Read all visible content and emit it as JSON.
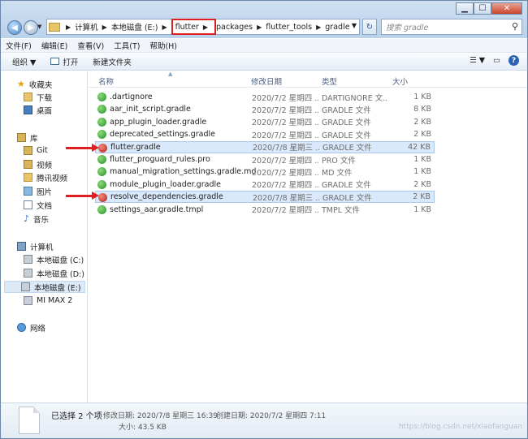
{
  "window_controls": {
    "minimize": "▁",
    "maximize": "☐",
    "close": "✕"
  },
  "nav": {
    "back": "◀",
    "forward": "▶",
    "history_dropdown": "▼"
  },
  "address": {
    "crumbs": [
      "计算机",
      "本地磁盘 (E:)",
      "flutter",
      "packages",
      "flutter_tools",
      "gradle"
    ],
    "highlighted_index": 2,
    "separator": "▶",
    "dropdown": "▼"
  },
  "refresh_glyph": "↻",
  "search": {
    "placeholder": "搜索 gradle"
  },
  "menu": [
    "文件(F)",
    "编辑(E)",
    "查看(V)",
    "工具(T)",
    "帮助(H)"
  ],
  "toolbar": {
    "organize": "组织 ▼",
    "open": "打开",
    "new_folder": "新建文件夹",
    "view": "☰ ▼",
    "preview": "▭",
    "help": "?"
  },
  "sidebar": {
    "favorites": "收藏夹",
    "favorites_items": [
      "下载",
      "桌面"
    ],
    "libraries": "库",
    "library_items": [
      "Git",
      "视频",
      "腾讯视频",
      "图片",
      "文档",
      "音乐"
    ],
    "computer": "计算机",
    "computer_items": [
      "本地磁盘 (C:)",
      "本地磁盘 (D:)",
      "本地磁盘 (E:)",
      "MI MAX 2"
    ],
    "selected_drive": "本地磁盘 (E:)",
    "network": "网络"
  },
  "columns": {
    "name": "名称",
    "date": "修改日期",
    "type": "类型",
    "size": "大小",
    "sort_glyph": "▲"
  },
  "files": [
    {
      "name": ".dartignore",
      "date": "2020/7/2 星期四 ...",
      "type": "DARTIGNORE 文...",
      "size": "1 KB",
      "icon": "green",
      "selected": false
    },
    {
      "name": "aar_init_script.gradle",
      "date": "2020/7/2 星期四 ...",
      "type": "GRADLE 文件",
      "size": "8 KB",
      "icon": "green",
      "selected": false
    },
    {
      "name": "app_plugin_loader.gradle",
      "date": "2020/7/2 星期四 ...",
      "type": "GRADLE 文件",
      "size": "2 KB",
      "icon": "green",
      "selected": false
    },
    {
      "name": "deprecated_settings.gradle",
      "date": "2020/7/2 星期四 ...",
      "type": "GRADLE 文件",
      "size": "2 KB",
      "icon": "green",
      "selected": false
    },
    {
      "name": "flutter.gradle",
      "date": "2020/7/8 星期三 ...",
      "type": "GRADLE 文件",
      "size": "42 KB",
      "icon": "red",
      "selected": true
    },
    {
      "name": "flutter_proguard_rules.pro",
      "date": "2020/7/2 星期四 ...",
      "type": "PRO 文件",
      "size": "1 KB",
      "icon": "green",
      "selected": false
    },
    {
      "name": "manual_migration_settings.gradle.md",
      "date": "2020/7/2 星期四 ...",
      "type": "MD 文件",
      "size": "1 KB",
      "icon": "green",
      "selected": false
    },
    {
      "name": "module_plugin_loader.gradle",
      "date": "2020/7/2 星期四 ...",
      "type": "GRADLE 文件",
      "size": "2 KB",
      "icon": "green",
      "selected": false
    },
    {
      "name": "resolve_dependencies.gradle",
      "date": "2020/7/8 星期三 ...",
      "type": "GRADLE 文件",
      "size": "2 KB",
      "icon": "red",
      "selected": true
    },
    {
      "name": "settings_aar.gradle.tmpl",
      "date": "2020/7/2 星期四 ...",
      "type": "TMPL 文件",
      "size": "1 KB",
      "icon": "green",
      "selected": false
    }
  ],
  "details": {
    "selected": "已选择 2 个项",
    "modified": "修改日期: 2020/7/8 星期三 16:39",
    "created": "创建日期: 2020/7/2 星期四 7:11",
    "size": "大小: 43.5 KB",
    "watermark": "https://blog.csdn.net/xiaofanguan"
  },
  "colors": {
    "highlight_box": "#e01e1e",
    "arrow": "#e02020",
    "selection": "#d9e8fa"
  }
}
